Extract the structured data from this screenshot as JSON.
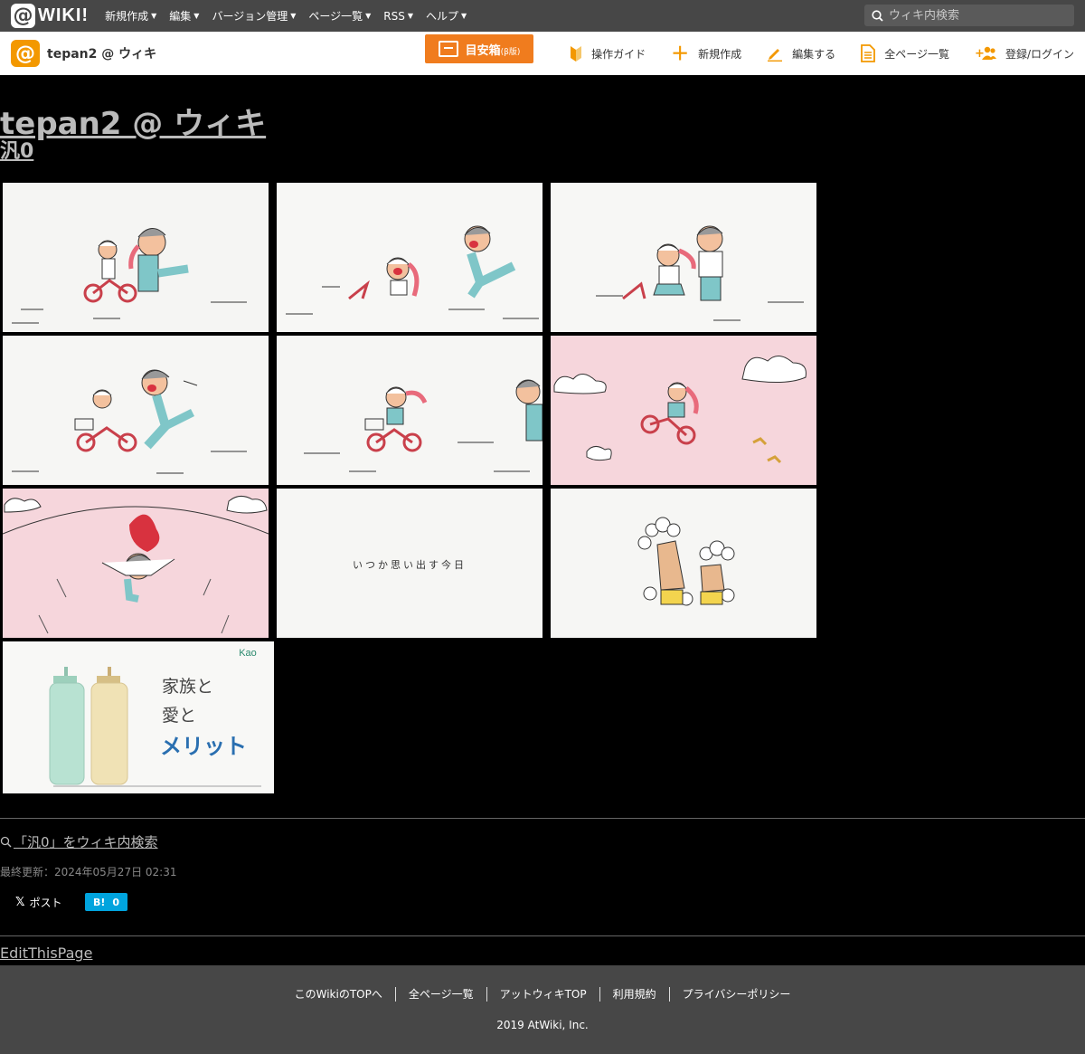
{
  "topbar": {
    "logo_at": "@",
    "logo_text": "WIKI!",
    "menu": [
      "新規作成",
      "編集",
      "バージョン管理",
      "ページ一覧",
      "RSS",
      "ヘルプ"
    ],
    "search_placeholder": "ウィキ内検索"
  },
  "subbar": {
    "wiki_icon": "@",
    "wiki_name": "tepan2 @ ウィキ",
    "meyasu_label": "目安箱",
    "meyasu_beta": "(β版)",
    "actions": [
      {
        "label": "操作ガイド",
        "icon": "beginner-icon"
      },
      {
        "label": "新規作成",
        "icon": "plus-icon"
      },
      {
        "label": "編集する",
        "icon": "pencil-icon"
      },
      {
        "label": "全ページ一覧",
        "icon": "document-icon"
      },
      {
        "label": "登録/ログイン",
        "icon": "add-user-icon"
      }
    ]
  },
  "main": {
    "site_title": "tepan2 @ ウィキ",
    "page_title": "汎0",
    "images": {
      "panel_8_text": "いつか思い出す今日",
      "ad_brand": "Kao",
      "ad_lines": [
        "家族と",
        "愛と",
        "メリット"
      ]
    },
    "search_link": "「汎0」をウィキ内検索",
    "last_updated": "最終更新：2024年05月27日 02:31",
    "post_label": "ポスト",
    "post_x": "𝕏",
    "hatena_b": "B!",
    "hatena_count": "0",
    "edit_link": "EditThisPage"
  },
  "footer": {
    "links": [
      "このWikiのTOPへ",
      "全ページ一覧",
      "アットウィキTOP",
      "利用規約",
      "プライバシーポリシー"
    ],
    "copyright": "2019 AtWiki, Inc."
  },
  "colors": {
    "accent": "#f39800",
    "topbar": "#474747",
    "pink": "#f6d6dc",
    "hatena": "#00a4de"
  }
}
